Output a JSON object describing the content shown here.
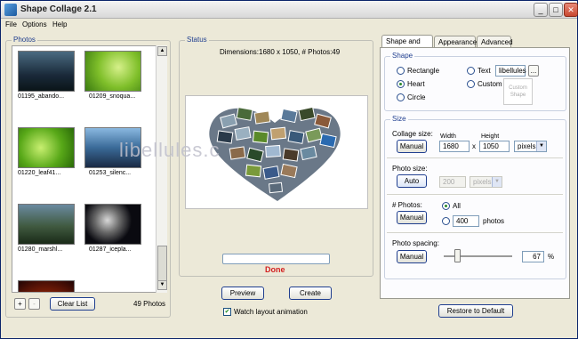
{
  "window": {
    "title": "Shape Collage 2.1",
    "min": "_",
    "max": "□",
    "close": "✕"
  },
  "menu": [
    "File",
    "Options",
    "Help"
  ],
  "photos": {
    "title": "Photos",
    "items": [
      {
        "label": "01195_abando..."
      },
      {
        "label": "01209_snoqua..."
      },
      {
        "label": "01220_leaf41..."
      },
      {
        "label": "01253_silenc..."
      },
      {
        "label": "01280_marshl..."
      },
      {
        "label": "01287_icepla..."
      }
    ],
    "add": "+",
    "remove": "-",
    "clear": "Clear List",
    "count": "49 Photos"
  },
  "status": {
    "title": "Status",
    "dimensions": "Dimensions:1680 x 1050, # Photos:49",
    "done": "Done",
    "preview": "Preview",
    "create": "Create",
    "watch": "Watch layout animation"
  },
  "watermark": "libellules.c",
  "tabs": [
    "Shape and Size",
    "Appearance",
    "Advanced"
  ],
  "shape": {
    "title": "Shape",
    "rectangle": "Rectangle",
    "heart": "Heart",
    "circle": "Circle",
    "text": "Text",
    "text_value": "libellules",
    "browse": "...",
    "custom": "Custom",
    "custom_shape_line1": "Custom",
    "custom_shape_line2": "Shape"
  },
  "size": {
    "title": "Size",
    "collage_size": "Collage size:",
    "manual": "Manual",
    "width_label": "Width",
    "height_label": "Height",
    "width": "1680",
    "height": "1050",
    "x": "x",
    "units": "pixels",
    "photo_size": "Photo size:",
    "auto": "Auto",
    "photo_size_value": "200",
    "photo_size_units": "pixels",
    "num_photos": "# Photos:",
    "manual2": "Manual",
    "all": "All",
    "count_value": "400",
    "photos_word": "photos",
    "spacing": "Photo spacing:",
    "manual3": "Manual",
    "spacing_value": "67",
    "percent": "%",
    "spacing_level": 0.2
  },
  "restore": "Restore to Default",
  "colors": {
    "done": "#d22020",
    "accent": "#1f3e8f"
  }
}
